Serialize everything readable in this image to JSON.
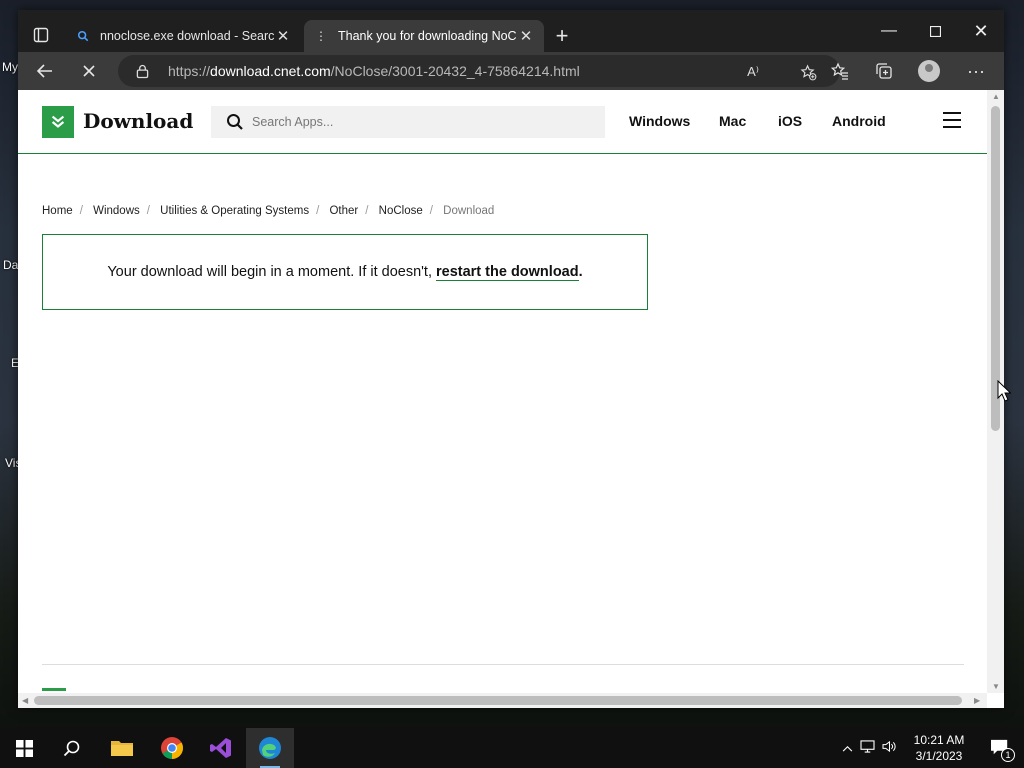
{
  "desktop": {
    "labels": [
      "My",
      "Da",
      "E",
      "Vis"
    ]
  },
  "browser": {
    "tabs": [
      {
        "title": "nnoclose.exe download - Search",
        "active": false
      },
      {
        "title": "Thank you for downloading NoC",
        "active": true
      }
    ],
    "address": {
      "prefix": "https://",
      "domain": "download.cnet.com",
      "path": "/NoClose/3001-20432_4-75864214.html"
    },
    "read_aloud": "A⁾"
  },
  "site": {
    "logo_text": "Download",
    "search_placeholder": "Search Apps...",
    "nav": [
      "Windows",
      "Mac",
      "iOS",
      "Android"
    ]
  },
  "breadcrumb": {
    "items": [
      "Home",
      "Windows",
      "Utilities & Operating Systems",
      "Other",
      "NoClose"
    ],
    "current": "Download"
  },
  "notice": {
    "text": "Your download will begin in a moment. If it doesn't,",
    "link": "restart the download",
    "tail": "."
  },
  "taskbar": {
    "time": "10:21 AM",
    "date": "3/1/2023",
    "notification_count": "1"
  },
  "colors": {
    "brand_green": "#2b9d48",
    "border_green": "#1a7f37"
  }
}
